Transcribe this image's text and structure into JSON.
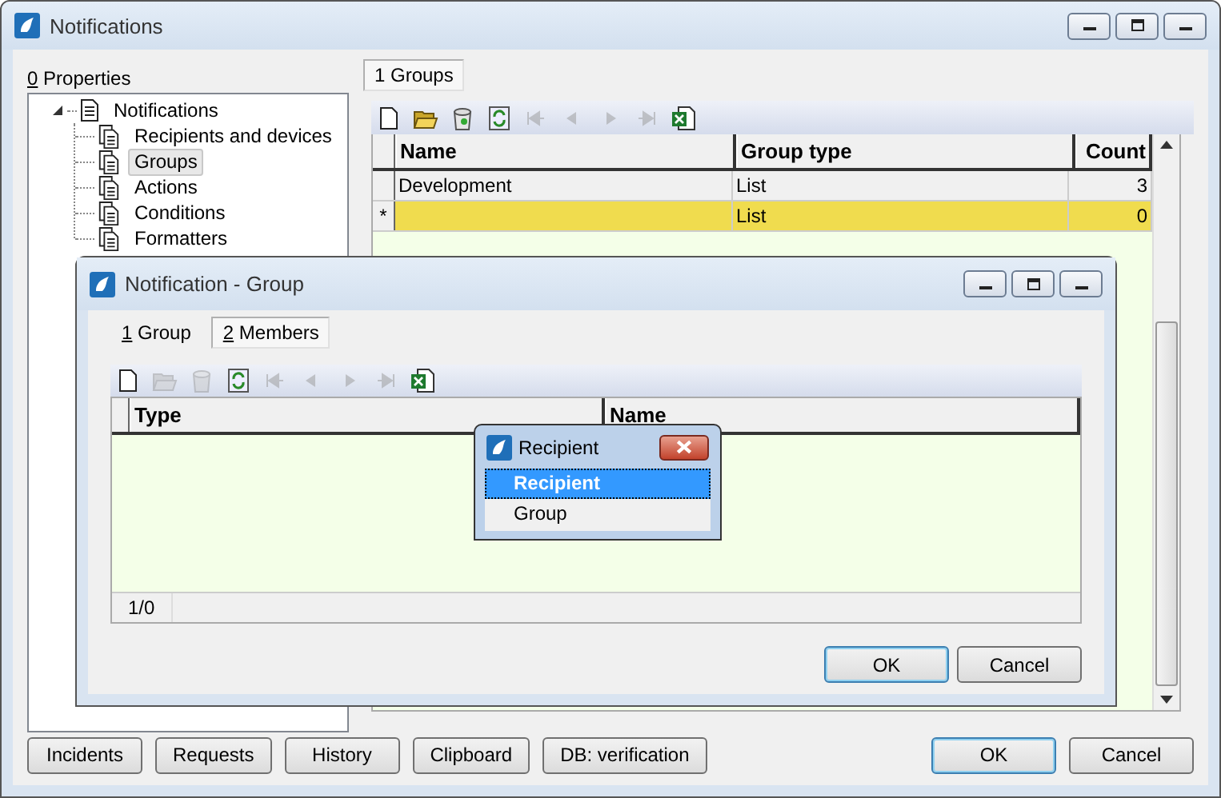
{
  "window": {
    "title": "Notifications"
  },
  "properties": {
    "key": "0",
    "label": "Properties"
  },
  "tree": [
    {
      "label": "Notifications",
      "expanded": true,
      "selected": false,
      "children": [
        {
          "label": "Recipients and devices",
          "selected": false
        },
        {
          "label": "Groups",
          "selected": true
        },
        {
          "label": "Actions",
          "selected": false
        },
        {
          "label": "Conditions",
          "selected": false
        },
        {
          "label": "Formatters",
          "selected": false
        }
      ]
    }
  ],
  "tabs": [
    {
      "label": "1 Groups",
      "selected": true
    }
  ],
  "toolbar": [
    {
      "kind": "new",
      "disabled": false
    },
    {
      "kind": "open",
      "disabled": false
    },
    {
      "kind": "delete",
      "disabled": false
    },
    {
      "kind": "refresh",
      "disabled": false
    },
    {
      "kind": "first",
      "disabled": true
    },
    {
      "kind": "prev",
      "disabled": true
    },
    {
      "kind": "next",
      "disabled": true
    },
    {
      "kind": "last",
      "disabled": true
    },
    {
      "kind": "excel",
      "disabled": false
    }
  ],
  "grid": {
    "columns": [
      "Name",
      "Group type",
      "Count"
    ],
    "rows": [
      {
        "name": "Development",
        "type": "List",
        "count": "3",
        "selected": false
      },
      {
        "marker": "*",
        "type": "List",
        "count": "0",
        "selected": true
      }
    ]
  },
  "footer_buttons": [
    "Incidents",
    "Requests",
    "History",
    "Clipboard",
    "DB: verification"
  ],
  "buttons": [
    {
      "label": "OK",
      "default": true
    },
    {
      "label": "Cancel",
      "default": false
    }
  ],
  "group_dialog": {
    "title": "Notification - Group",
    "tabs": [
      {
        "key": "1",
        "label": "Group",
        "selected": false
      },
      {
        "key": "2",
        "label": "Members",
        "selected": true
      }
    ],
    "toolbar": [
      {
        "kind": "new",
        "disabled": false
      },
      {
        "kind": "open",
        "disabled": true
      },
      {
        "kind": "delete",
        "disabled": true
      },
      {
        "kind": "refresh",
        "disabled": false
      },
      {
        "kind": "first",
        "disabled": true
      },
      {
        "kind": "prev",
        "disabled": true
      },
      {
        "kind": "next",
        "disabled": true
      },
      {
        "kind": "last",
        "disabled": true
      },
      {
        "kind": "excel",
        "disabled": false
      }
    ],
    "columns": [
      "Type",
      "Name"
    ],
    "status": "1/0",
    "buttons": [
      {
        "label": "OK",
        "default": true
      },
      {
        "label": "Cancel",
        "default": false
      }
    ]
  },
  "popup": {
    "title": "Recipient",
    "items": [
      {
        "label": "Recipient",
        "selected": true
      },
      {
        "label": "Group",
        "selected": false
      }
    ]
  }
}
